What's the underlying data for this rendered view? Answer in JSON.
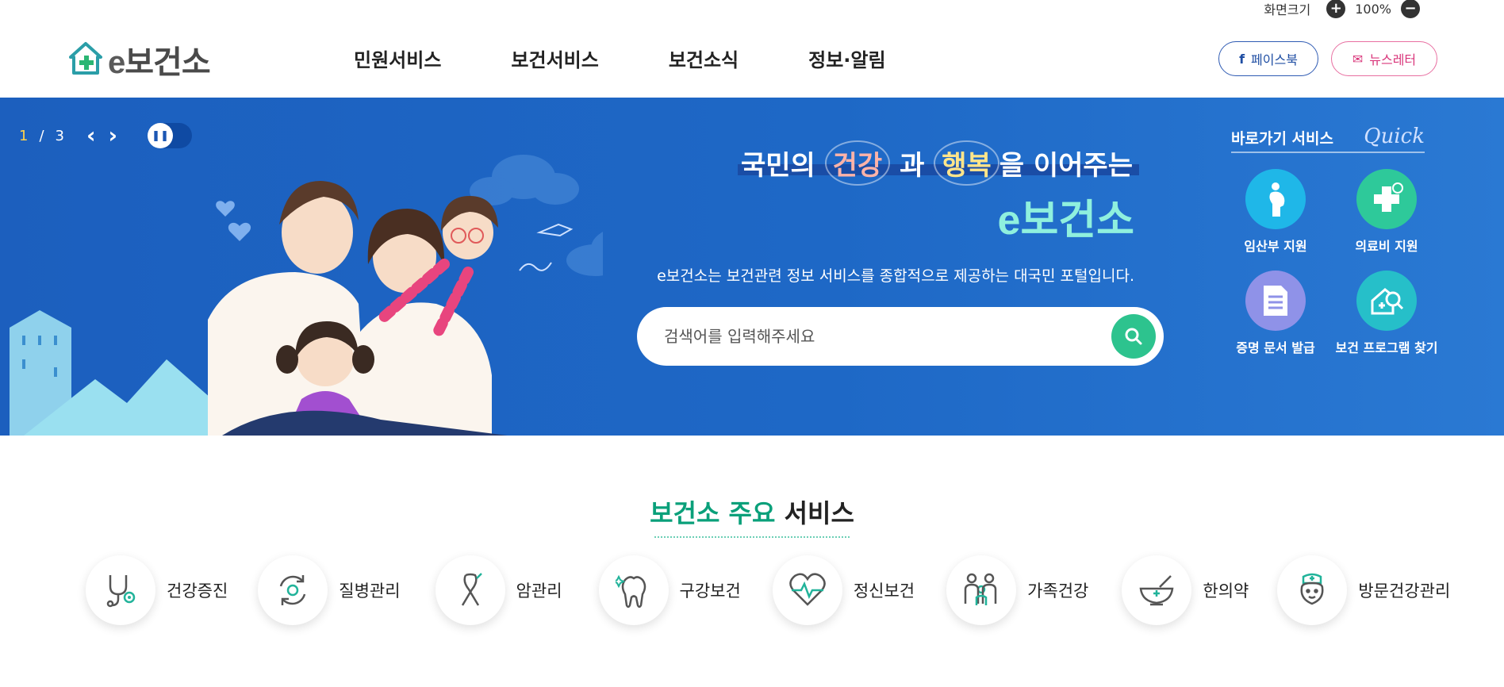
{
  "util": {
    "screen_size_label": "화면크기",
    "zoom_in": "+",
    "zoom_value": "100%",
    "zoom_out": "−"
  },
  "header": {
    "logo_e": "e",
    "logo_text": "보건소",
    "nav": [
      "민원서비스",
      "보건서비스",
      "보건소식",
      "정보·알림"
    ],
    "facebook_label": "페이스북",
    "newsletter_label": "뉴스레터"
  },
  "hero": {
    "slide_current": "1",
    "slide_sep": "/",
    "slide_total": "3",
    "headline_pre": "국민의",
    "headline_w1": "건강",
    "headline_mid": "과",
    "headline_w2": "행복",
    "headline_post": "을 이어주는",
    "brand": "e보건소",
    "description": "e보건소는 보건관련 정보 서비스를 종합적으로 제공하는 대국민 포털입니다.",
    "search_placeholder": "검색어를 입력해주세요"
  },
  "quick": {
    "title": "바로가기 서비스",
    "quick_script": "Quick",
    "items": [
      {
        "label": "임산부 지원",
        "icon": "pregnant-woman-icon",
        "color": "#1fb7e8"
      },
      {
        "label": "의료비 지원",
        "icon": "medical-cross-icon",
        "color": "#2ec99a"
      },
      {
        "label": "증명 문서 발급",
        "icon": "document-icon",
        "color": "#8f92e8"
      },
      {
        "label": "보건 프로그램 찾기",
        "icon": "search-program-icon",
        "color": "#26bfc9"
      }
    ]
  },
  "services": {
    "title_green": "보건소 주요",
    "title_rest": "서비스",
    "items": [
      {
        "label": "건강증진",
        "icon": "stethoscope-icon"
      },
      {
        "label": "질병관리",
        "icon": "virus-cycle-icon"
      },
      {
        "label": "암관리",
        "icon": "ribbon-icon"
      },
      {
        "label": "구강보건",
        "icon": "tooth-icon"
      },
      {
        "label": "정신보건",
        "icon": "heart-pulse-icon"
      },
      {
        "label": "가족건강",
        "icon": "family-icon"
      },
      {
        "label": "한의약",
        "icon": "mortar-icon"
      },
      {
        "label": "방문건강관리",
        "icon": "nurse-icon"
      }
    ]
  },
  "colors": {
    "hero_blue": "#1e64c2",
    "accent_green": "#0aa07a",
    "search_green": "#2dc38e"
  }
}
